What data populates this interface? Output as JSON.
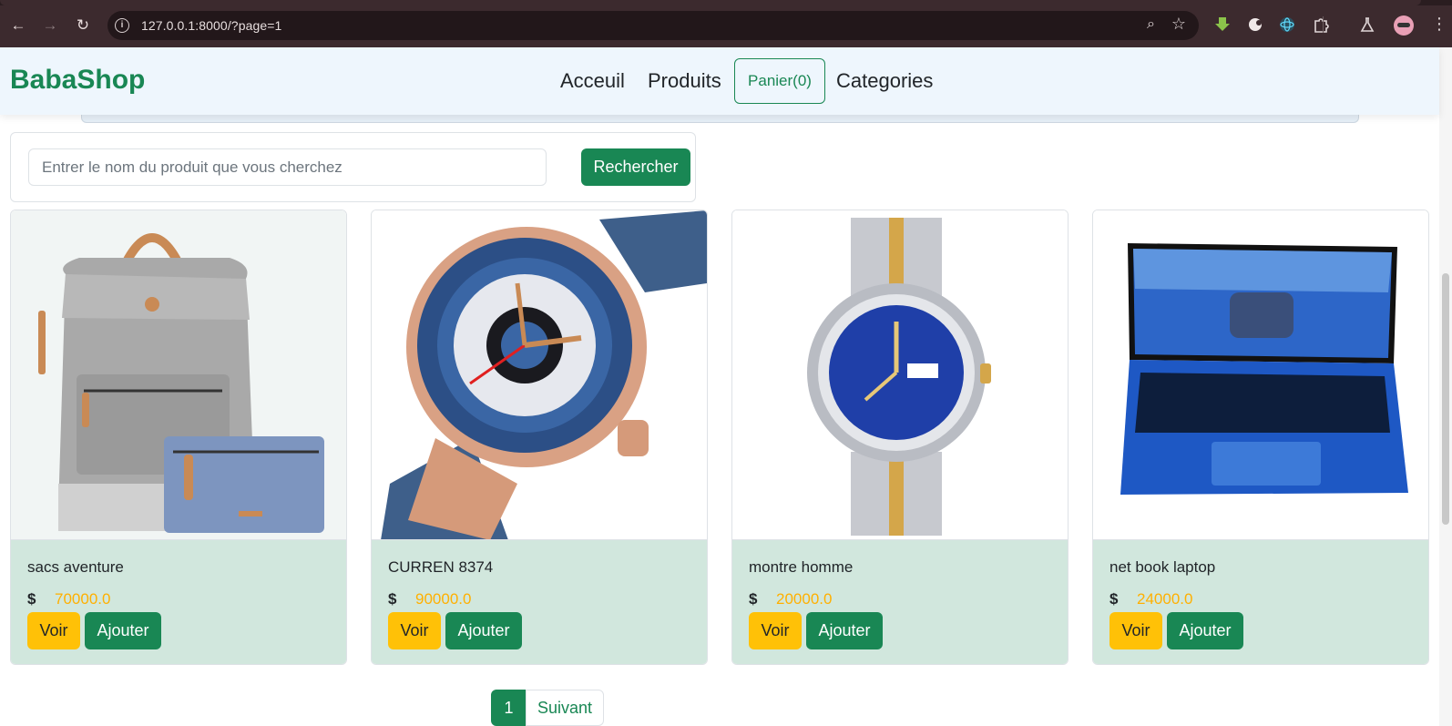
{
  "browser": {
    "url": "127.0.0.1:8000/?page=1",
    "back_icon": "←",
    "forward_icon": "→",
    "reload_icon": "↻",
    "info_icon": "i",
    "zoom_icon": "⌕",
    "star_icon": "☆",
    "menu_icon": "⋮"
  },
  "navbar": {
    "brand": "BabaShop",
    "links": [
      "Acceuil",
      "Produits",
      "Categories"
    ],
    "cart_label": "Panier(0)"
  },
  "search": {
    "placeholder": "Entrer le nom du produit que vous cherchez",
    "button": "Rechercher"
  },
  "products": [
    {
      "name": "sacs aventure",
      "currency": "$",
      "price": "70000.0",
      "view": "Voir",
      "add": "Ajouter"
    },
    {
      "name": "CURREN 8374",
      "currency": "$",
      "price": "90000.0",
      "view": "Voir",
      "add": "Ajouter"
    },
    {
      "name": "montre homme",
      "currency": "$",
      "price": "20000.0",
      "view": "Voir",
      "add": "Ajouter"
    },
    {
      "name": "net book laptop",
      "currency": "$",
      "price": "24000.0",
      "view": "Voir",
      "add": "Ajouter"
    }
  ],
  "pagination": {
    "current": "1",
    "next": "Suivant"
  },
  "colors": {
    "brand": "#198754",
    "warning": "#ffc107",
    "card_body": "#d1e7dd",
    "price": "#ffb000"
  }
}
